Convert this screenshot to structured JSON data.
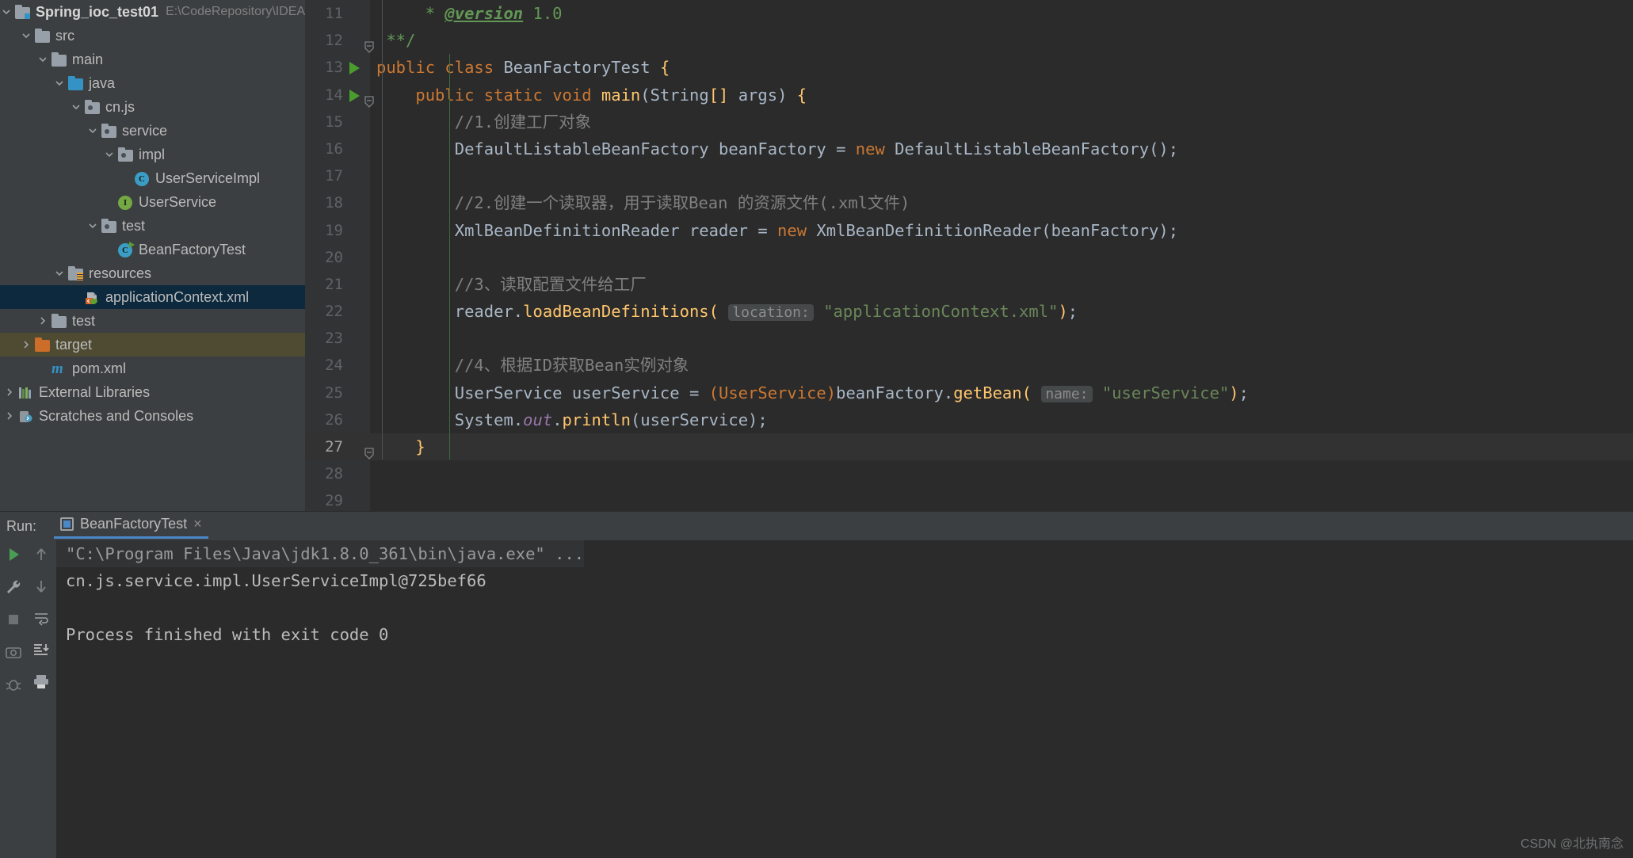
{
  "project": {
    "root_name": "Spring_ioc_test01",
    "root_path": "E:\\CodeRepository\\IDEA\\Sprir",
    "items": [
      {
        "label": "src",
        "icon": "folder-icon",
        "depth": 1,
        "arrow": "down"
      },
      {
        "label": "main",
        "icon": "folder-icon",
        "depth": 2,
        "arrow": "down"
      },
      {
        "label": "java",
        "icon": "folder-source-icon",
        "depth": 3,
        "arrow": "down"
      },
      {
        "label": "cn.js",
        "icon": "package-icon",
        "depth": 4,
        "arrow": "down"
      },
      {
        "label": "service",
        "icon": "package-icon",
        "depth": 5,
        "arrow": "down"
      },
      {
        "label": "impl",
        "icon": "package-icon",
        "depth": 6,
        "arrow": "down"
      },
      {
        "label": "UserServiceImpl",
        "icon": "java-class-icon",
        "depth": 7,
        "arrow": "none"
      },
      {
        "label": "UserService",
        "icon": "java-interface-icon",
        "depth": 6,
        "arrow": "none"
      },
      {
        "label": "test",
        "icon": "package-icon",
        "depth": 5,
        "arrow": "down"
      },
      {
        "label": "BeanFactoryTest",
        "icon": "java-test-class-icon",
        "depth": 6,
        "arrow": "none"
      },
      {
        "label": "resources",
        "icon": "folder-resources-icon",
        "depth": 3,
        "arrow": "down"
      },
      {
        "label": "applicationContext.xml",
        "icon": "spring-xml-icon",
        "depth": 4,
        "arrow": "none",
        "state": "selected"
      },
      {
        "label": "test",
        "icon": "folder-icon",
        "depth": 2,
        "arrow": "right"
      },
      {
        "label": "target",
        "icon": "folder-excluded-icon",
        "depth": 1,
        "arrow": "right",
        "state": "highlight"
      },
      {
        "label": "pom.xml",
        "icon": "maven-icon",
        "depth": 2,
        "arrow": "none"
      },
      {
        "label": "External Libraries",
        "icon": "libraries-icon",
        "depth": 0,
        "arrow": "right"
      },
      {
        "label": "Scratches and Consoles",
        "icon": "scratches-icon",
        "depth": 0,
        "arrow": "right"
      }
    ]
  },
  "editor": {
    "first_visible_line": 11,
    "lines": [
      {
        "n": 11,
        "html": "<span class='doc'>     * </span><span class='tag'>@version</span><span class='doc'> 1.0</span>"
      },
      {
        "n": 12,
        "html": "<span class='doc'> **/</span>",
        "fold": true
      },
      {
        "n": 13,
        "html": "<span class='kw'>public</span> <span class='kw'>class</span> <span class='cls'>BeanFactoryTest</span> <span class='brace-y'>{</span>",
        "runmark": true
      },
      {
        "n": 14,
        "html": "    <span class='kw'>public</span> <span class='kw'>static</span> <span class='kw'>void</span> <span class='fn'>main</span>(<span class='cls'>String</span><span class='brace-y'>[]</span> args) <span class='brace-y'>{</span>",
        "runmark": true,
        "fold": true
      },
      {
        "n": 15,
        "html": "        <span class='cmt'>//1.创建工厂对象</span>"
      },
      {
        "n": 16,
        "html": "        <span class='cls'>DefaultListableBeanFactory</span> beanFactory = <span class='kw'>new</span> <span class='cls'>DefaultListableBeanFactory</span>();"
      },
      {
        "n": 17,
        "html": ""
      },
      {
        "n": 18,
        "html": "        <span class='cmt'>//2.创建一个读取器，用于读取Bean 的资源文件(.xml文件)</span>"
      },
      {
        "n": 19,
        "html": "        <span class='cls'>XmlBeanDefinitionReader</span> reader = <span class='kw'>new</span> <span class='cls'>XmlBeanDefinitionReader</span>(beanFactory);"
      },
      {
        "n": 20,
        "html": ""
      },
      {
        "n": 21,
        "html": "        <span class='cmt'>//3、读取配置文件给工厂</span>"
      },
      {
        "n": 22,
        "html": "        reader.<span class='fn'>loadBeanDefinitions</span><span class='brace-y'>(</span> <span class='hint'>location:</span> <span class='str'>\"applicationContext.xml\"</span><span class='brace-y'>)</span>;"
      },
      {
        "n": 23,
        "html": ""
      },
      {
        "n": 24,
        "html": "        <span class='cmt'>//4、根据ID获取Bean实例对象</span>"
      },
      {
        "n": 25,
        "html": "        <span class='cls'>UserService</span> userService = <span class='casted'>(UserService)</span>beanFactory.<span class='fn'>getBean</span><span class='brace-y'>(</span> <span class='hint'>name:</span> <span class='str'>\"userService\"</span><span class='brace-y'>)</span>;"
      },
      {
        "n": 26,
        "html": "        <span class='cls'>System</span>.<span class='fld'>out</span>.<span class='fn'>println</span>(userService);"
      },
      {
        "n": 27,
        "html": "    <span class='brace-y'>}</span>",
        "current": true,
        "fold": true
      },
      {
        "n": 28,
        "html": ""
      },
      {
        "n": 29,
        "html": ""
      }
    ]
  },
  "run": {
    "label": "Run:",
    "tab_name": "BeanFactoryTest",
    "tab_close": "×",
    "console": [
      {
        "text": "\"C:\\Program Files\\Java\\jdk1.8.0_361\\bin\\java.exe\" ...",
        "style": "dim"
      },
      {
        "text": "cn.js.service.impl.UserServiceImpl@725bef66",
        "style": "normal"
      },
      {
        "text": "",
        "style": "normal"
      },
      {
        "text": "Process finished with exit code 0",
        "style": "normal"
      }
    ],
    "toolbar_left": [
      "rerun-icon",
      "settings-wrench-icon",
      "stop-icon",
      "camera-icon",
      "debug-icon"
    ],
    "toolbar_second": [
      "up-arrow-icon",
      "down-arrow-icon",
      "soft-wrap-icon",
      "scroll-to-end-icon",
      "print-icon"
    ]
  },
  "watermark": "CSDN @北执南念",
  "colors": {
    "panel_bg": "#3c3f41",
    "editor_bg": "#2b2b2b",
    "gutter_bg": "#313335",
    "selection_blue": "#0d293e",
    "target_highlight": "#4f4b32",
    "accent_blue": "#4a88c7",
    "keyword_orange": "#cc7832",
    "string_green": "#6a8759",
    "comment_gray": "#808080",
    "method_yellow": "#ffc66d",
    "text_gray": "#a9b7c6"
  }
}
